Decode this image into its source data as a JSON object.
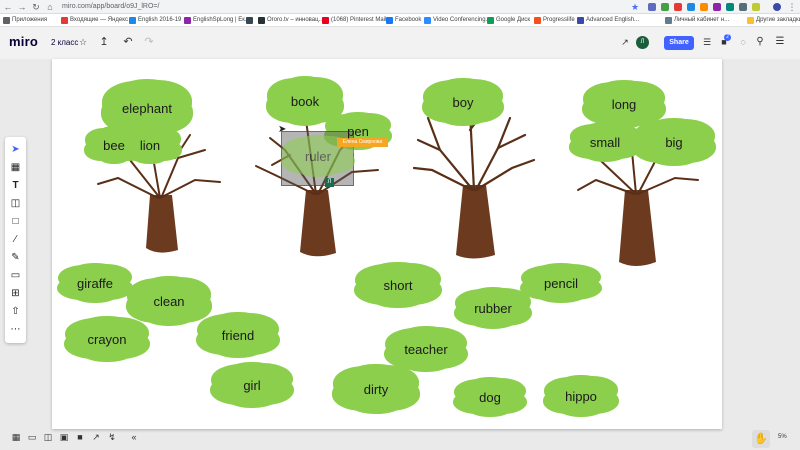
{
  "browser": {
    "url": "miro.com/app/board/o9J_lRO=/",
    "bookmarks": [
      {
        "label": "Приложения",
        "color": "#5f6368"
      },
      {
        "label": "Входящие — Яндекс",
        "color": "#e53935"
      },
      {
        "label": "English 2016-19",
        "color": "#1e88e5"
      },
      {
        "label": "EnglishSpLong | Ек...",
        "color": "#8e24aa"
      },
      {
        "label": "",
        "color": "#37474f"
      },
      {
        "label": "Ororo.tv – инновац...",
        "color": "#263238"
      },
      {
        "label": "(1068) Pinterest Mail",
        "color": "#e60023"
      },
      {
        "label": "Facebook",
        "color": "#1877f2"
      },
      {
        "label": "Video Conferencing...",
        "color": "#2d8cff"
      },
      {
        "label": "Google Диск",
        "color": "#0f9d58"
      },
      {
        "label": "Progresslife",
        "color": "#f4511e"
      },
      {
        "label": "Advanced English...",
        "color": "#3949ab"
      },
      {
        "label": "Личный кабинет н...",
        "color": "#607d8b"
      },
      {
        "label": "Другие закладки",
        "color": "#fbc02d"
      }
    ]
  },
  "topbar": {
    "logo": "miro",
    "board_title": "2 класс",
    "share_label": "Share",
    "avatar_initial": "Л",
    "notification_count": "2"
  },
  "words": {
    "elephant": "elephant",
    "bee": "bee",
    "lion": "lion",
    "book": "book",
    "pen": "pen",
    "ruler": "ruler",
    "boy": "boy",
    "long": "long",
    "small": "small",
    "big": "big",
    "giraffe": "giraffe",
    "clean": "clean",
    "crayon": "crayon",
    "friend": "friend",
    "girl": "girl",
    "short": "short",
    "dirty": "dirty",
    "teacher": "teacher",
    "rubber": "rubber",
    "pencil": "pencil",
    "dog": "dog",
    "hippo": "hippo"
  },
  "cursor_label": "Елена Смирнова",
  "selection_handle": "Л",
  "zoom_level": "5%",
  "colors": {
    "cloud": "#8ccf4d",
    "trunk": "#6b3a1f",
    "accent": "#4262ff"
  }
}
